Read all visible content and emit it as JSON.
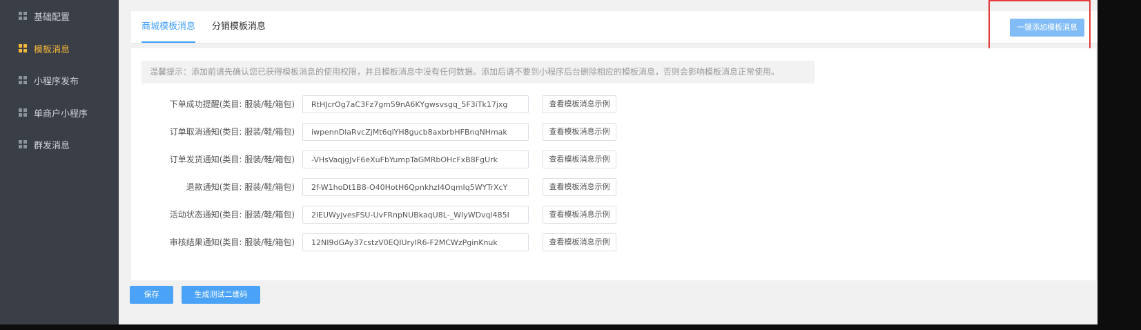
{
  "sidebar": {
    "items": [
      {
        "label": "基础配置",
        "icon": "grid-icon",
        "active": false
      },
      {
        "label": "模板消息",
        "icon": "grid-icon",
        "active": true
      },
      {
        "label": "小程序发布",
        "icon": "grid-icon",
        "active": false
      },
      {
        "label": "单商户小程序",
        "icon": "grid-icon",
        "active": false
      },
      {
        "label": "群发消息",
        "icon": "grid-icon",
        "active": false
      }
    ]
  },
  "tabs": [
    {
      "label": "商城模板消息",
      "active": true
    },
    {
      "label": "分销模板消息",
      "active": false
    }
  ],
  "add_button_label": "一键添加模板消息",
  "notice": "温馨提示：添加前请先确认您已获得模板消息的使用权限，并且模板消息中没有任何数据。添加后请不要到小程序后台删除相应的模板消息，否则会影响模板消息正常使用。",
  "templates": [
    {
      "label": "下单成功提醒(类目: 服装/鞋/箱包)",
      "value": "RtHJcrOg7aC3Fz7gm59nA6KYgwsvsgq_5F3iTk17jxg",
      "button": "查看模板消息示例"
    },
    {
      "label": "订单取消通知(类目: 服装/鞋/箱包)",
      "value": "iwpennDlaRvcZjMt6qlYH8gucb8axbrbHFBnqNHmak",
      "button": "查看模板消息示例"
    },
    {
      "label": "订单发货通知(类目: 服装/鞋/箱包)",
      "value": "-VHsVaqjgJvF6eXuFbYumpTaGMRbOHcFxB8FgUrk",
      "button": "查看模板消息示例"
    },
    {
      "label": "退款通知(类目: 服装/鞋/箱包)",
      "value": "2f-W1hoDt1B8-O40HotH6QpnkhzI4OqmIq5WYTrXcY",
      "button": "查看模板消息示例"
    },
    {
      "label": "活动状态通知(类目: 服装/鞋/箱包)",
      "value": "2lEUWyjvesFSU-UvFRnpNUBkaqU8L-_WIyWDvql485I",
      "button": "查看模板消息示例"
    },
    {
      "label": "审核结果通知(类目: 服装/鞋/箱包)",
      "value": "12NI9dGAy37cstzV0EQIUryIR6-F2MCWzPginKnuk",
      "button": "查看模板消息示例"
    }
  ],
  "footer": {
    "save_label": "保存",
    "qr_label": "生成测试二维码"
  },
  "colors": {
    "sidebar_bg": "#3a3e46",
    "active_accent": "#f5b83a",
    "primary": "#4ba3f7",
    "highlight_border": "#e53b3b"
  }
}
